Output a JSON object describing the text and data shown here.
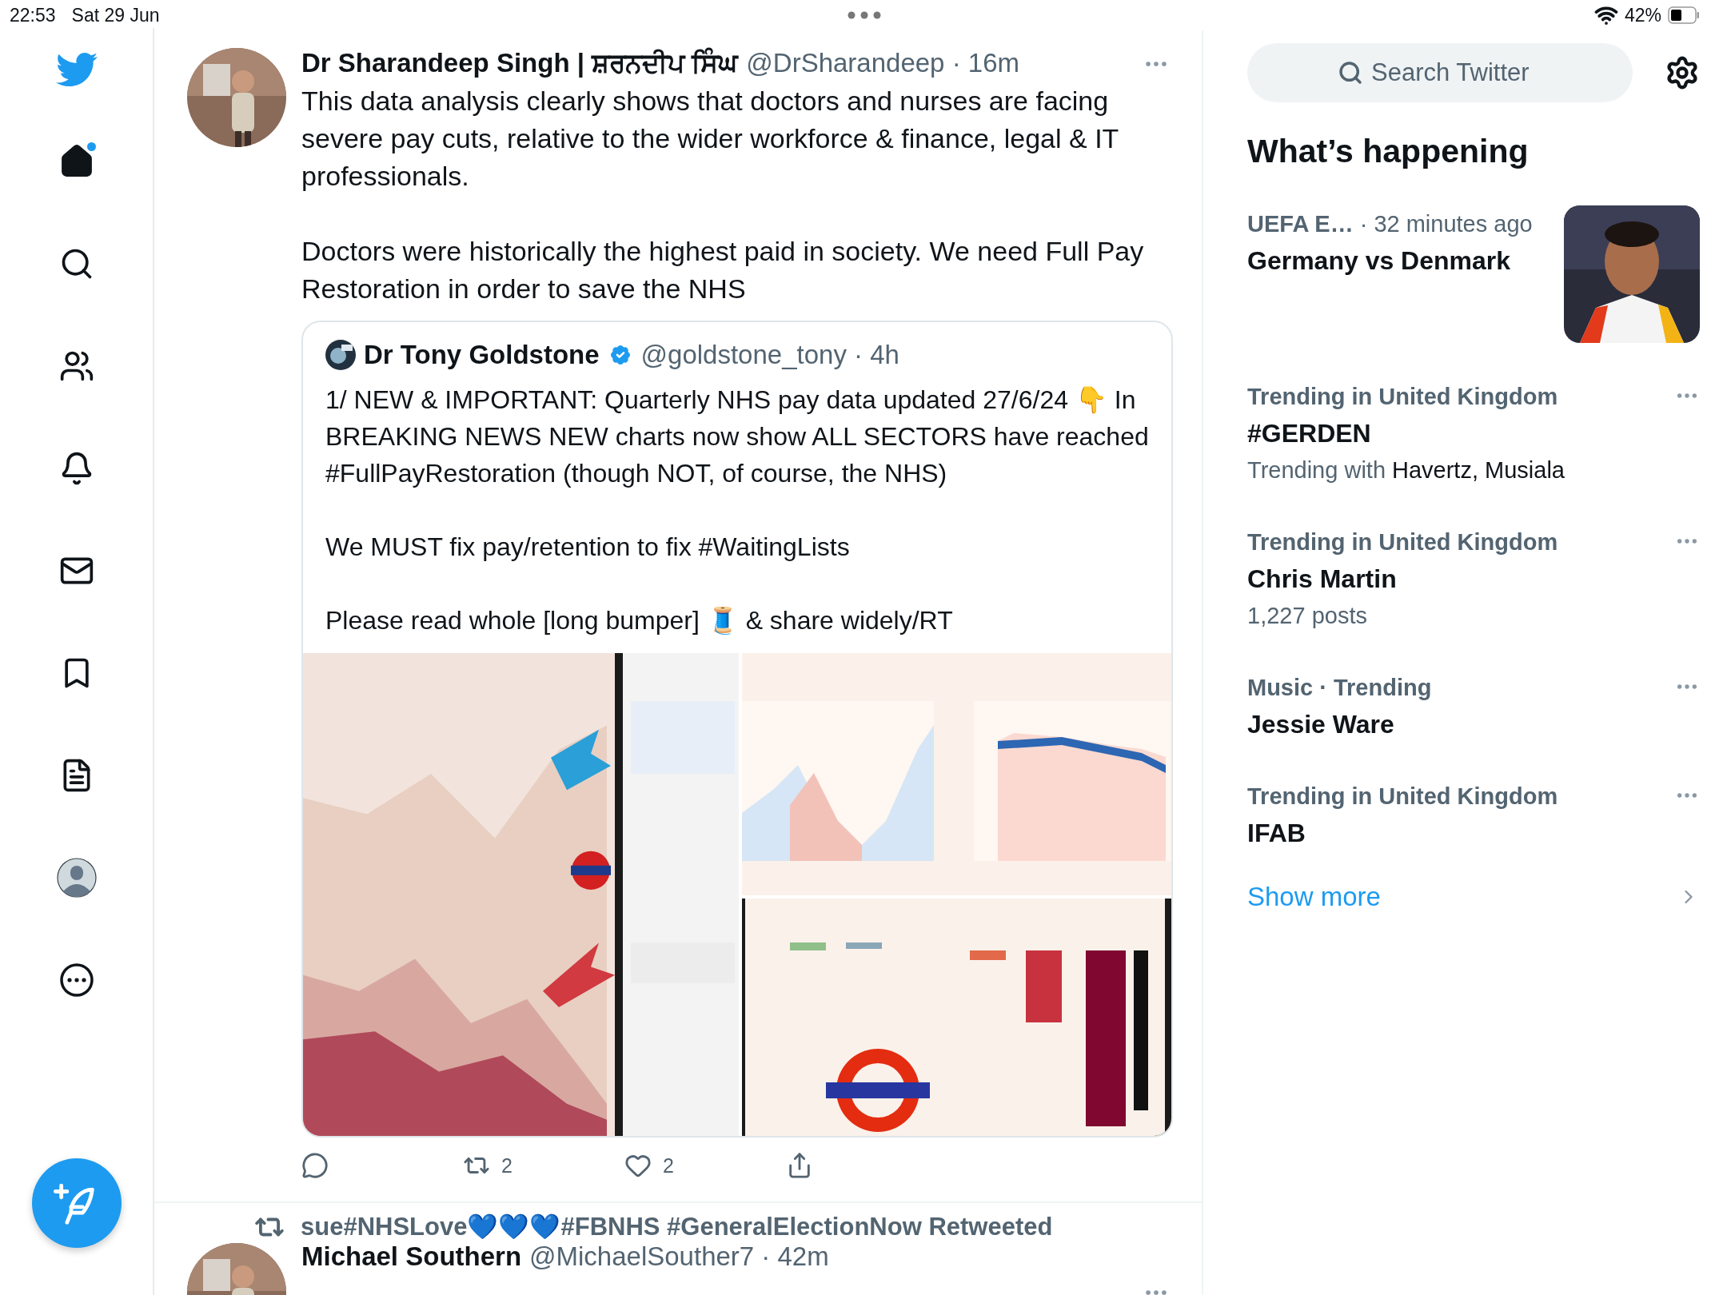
{
  "status_bar": {
    "time": "22:53",
    "date": "Sat 29 Jun",
    "battery": "42%"
  },
  "sidebar": {
    "items": [
      {
        "kind": "home",
        "selected": true,
        "notification": true
      },
      {
        "kind": "search",
        "selected": false,
        "notification": false
      },
      {
        "kind": "communities",
        "selected": false,
        "notification": false
      },
      {
        "kind": "notifications",
        "selected": false,
        "notification": false
      },
      {
        "kind": "messages",
        "selected": false,
        "notification": false
      },
      {
        "kind": "bookmarks",
        "selected": false,
        "notification": false
      },
      {
        "kind": "lists",
        "selected": false,
        "notification": false
      },
      {
        "kind": "profile",
        "selected": false,
        "notification": false
      },
      {
        "kind": "more",
        "selected": false,
        "notification": false
      }
    ]
  },
  "timeline": {
    "tweets": [
      {
        "kind": "full",
        "author": {
          "name": "Dr Sharandeep Singh | ਸ਼ਰਨਦੀਪ ਸਿੰਘ",
          "meta": "@DrSharandeep · 16m"
        },
        "paragraphs": [
          "This data analysis clearly shows that doctors and nurses are facing severe pay cuts, relative to the wider workforce & finance, legal & IT professionals.",
          "Doctors were historically the highest paid in society. We need Full Pay Restoration in order to save the NHS"
        ],
        "quote": {
          "author": {
            "name": "Dr Tony Goldstone",
            "verified": true,
            "meta": "@goldstone_tony · 4h"
          },
          "paragraphs": [
            "1/ NEW & IMPORTANT: Quarterly NHS pay data updated 27/6/24 👇 In BREAKING NEWS NEW charts now show ALL SECTORS have reached #FullPayRestoration (though NOT, of course, the NHS)",
            "We MUST fix pay/retention to fix #WaitingLists",
            "Please read whole [long bumper] 🧵 & share widely/RT"
          ],
          "media": [
            {
              "kind": "picture"
            },
            {
              "kind": "picture"
            },
            {
              "kind": "picture"
            }
          ]
        },
        "actions": [
          {
            "kind": "reply"
          },
          {
            "kind": "retweet",
            "count": "2"
          },
          {
            "kind": "like",
            "count": "2"
          },
          {
            "kind": "share"
          }
        ]
      },
      {
        "kind": "partial",
        "social_context": "sue#NHSLove💙💙💙#FBNHS #GeneralElectionNow Retweeted",
        "author": {
          "name": "Michael Southern",
          "meta": "@MichaelSouther7 · 42m"
        }
      }
    ]
  },
  "aside": {
    "search": {
      "placeholder": "Search Twitter"
    },
    "heading": "What’s happening",
    "trends": [
      {
        "kind": "event",
        "context": "UEFA E…",
        "time": "· 32 minutes ago",
        "title": "Germany vs Denmark"
      },
      {
        "kind": "trend",
        "context": "Trending in United Kingdom",
        "title": "#GERDEN",
        "sub_lead": "Trending with",
        "sub": "Havertz, Musiala"
      },
      {
        "kind": "trend",
        "context": "Trending in United Kingdom",
        "title": "Chris Martin",
        "sub_lead": "1,227 posts"
      },
      {
        "kind": "trend",
        "context": "Music · Trending",
        "title": "Jessie Ware"
      },
      {
        "kind": "trend",
        "context": "Trending in United Kingdom",
        "title": "IFAB"
      }
    ],
    "show_more": "Show more"
  }
}
